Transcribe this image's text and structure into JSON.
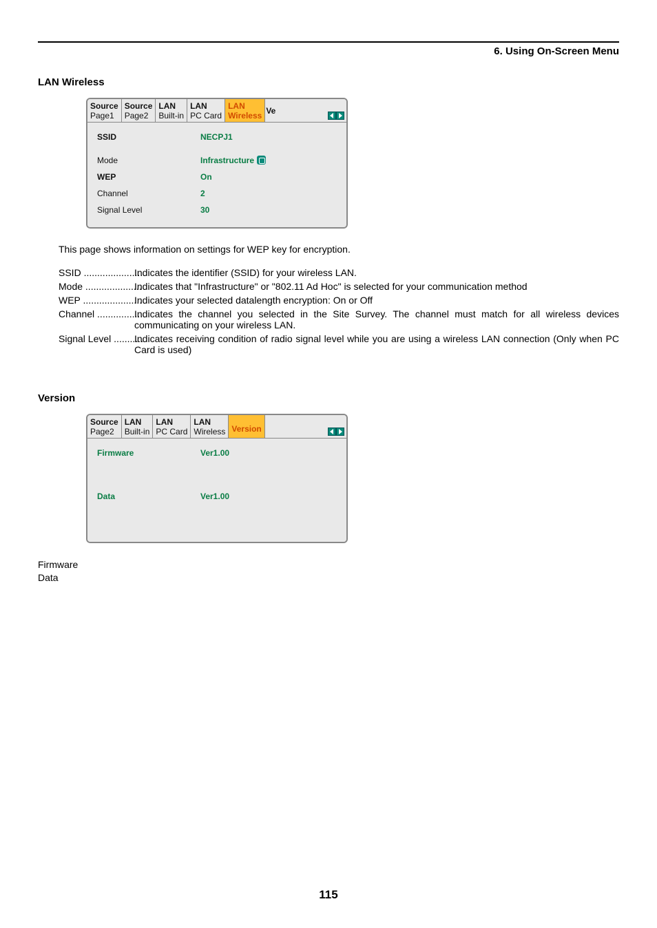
{
  "chapter": "6. Using On-Screen Menu",
  "page_number": "115",
  "lan_wireless": {
    "heading": "LAN Wireless",
    "tabs": [
      {
        "l1": "Source",
        "l2": "Page1"
      },
      {
        "l1": "Source",
        "l2": "Page2"
      },
      {
        "l1": "LAN",
        "l2": "Built-in"
      },
      {
        "l1": "LAN",
        "l2": "PC Card"
      },
      {
        "l1": "LAN",
        "l2": "Wireless",
        "active": true
      }
    ],
    "cut_tab": "Ve",
    "rows": [
      {
        "label": "SSID",
        "value": "NECPJ1",
        "bold": true
      },
      {
        "label": "Mode",
        "value": "Infrastructure",
        "bold": false,
        "icon": true
      },
      {
        "label": "WEP",
        "value": "On",
        "bold": true
      },
      {
        "label": "Channel",
        "value": "2",
        "bold": false
      },
      {
        "label": "Signal Level",
        "value": "30",
        "bold": false
      }
    ],
    "intro": "This page shows information on settings for WEP key for encryption.",
    "defs": [
      {
        "term": "SSID",
        "desc": "Indicates the identifier (SSID) for your wireless LAN."
      },
      {
        "term": "Mode",
        "desc": "Indicates that \"Infrastructure\" or \"802.11 Ad Hoc\" is selected for your communication method"
      },
      {
        "term": "WEP",
        "desc": "Indicates your selected datalength encryption: On or Off"
      },
      {
        "term": "Channel",
        "desc": "Indicates the channel you selected in the Site Survey. The channel must match for all wireless devices communicating on your wireless LAN."
      },
      {
        "term": "Signal Level",
        "desc": "Indicates receiving condition of radio signal level while you are using a wireless LAN connection (Only when PC Card is used)"
      }
    ]
  },
  "version": {
    "heading": "Version",
    "tabs": [
      {
        "l1": "Source",
        "l2": "Page2"
      },
      {
        "l1": "LAN",
        "l2": "Built-in"
      },
      {
        "l1": "LAN",
        "l2": "PC Card"
      },
      {
        "l1": "LAN",
        "l2": "Wireless"
      },
      {
        "l1": "Version",
        "l2": "",
        "active": true
      }
    ],
    "rows": [
      {
        "label": "Firmware",
        "value": "Ver1.00"
      },
      {
        "label": "Data",
        "value": "Ver1.00"
      }
    ],
    "below_lines": [
      "Firmware",
      "Data"
    ]
  }
}
